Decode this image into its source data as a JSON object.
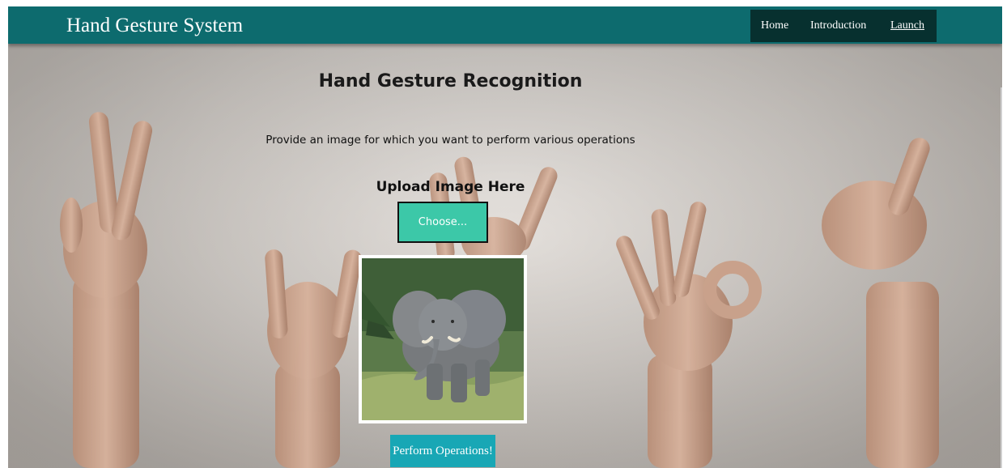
{
  "navbar": {
    "brand": "Hand Gesture System",
    "links": [
      {
        "label": "Home"
      },
      {
        "label": "Introduction"
      },
      {
        "label": "Launch"
      }
    ]
  },
  "main": {
    "title": "Hand Gesture Recognition",
    "subtitle": "Provide an image for which you want to perform various operations",
    "upload_label": "Upload Image Here",
    "choose_button": "Choose...",
    "perform_button": "Perform Operations!"
  },
  "colors": {
    "navbar": "#0d6b6e",
    "nav_links_bg": "#07302f",
    "choose_button": "#3cc8a8",
    "perform_button": "#18a7b5"
  }
}
